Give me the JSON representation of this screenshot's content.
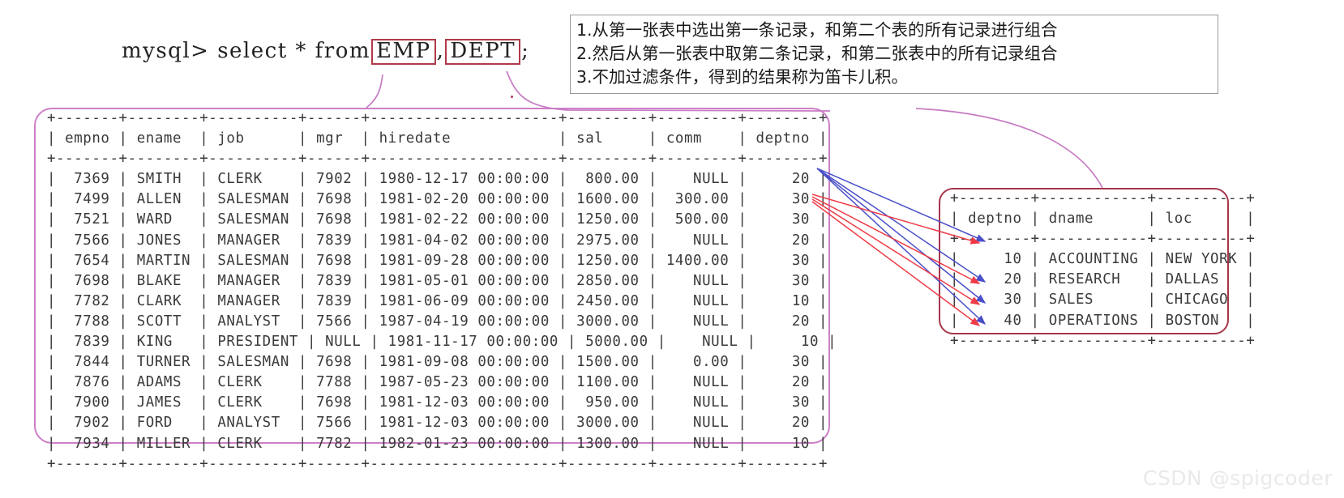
{
  "prompt": {
    "before": "mysql> select * from ",
    "table1": "EMP",
    "comma": ", ",
    "table2": "DEPT",
    "terminator": ";"
  },
  "note": {
    "line1": "1.从第一张表中选出第一条记录，和第二个表的所有记录进行组合",
    "line2": "2.然后从第一张表中取第二条记录，和第二张表中的所有记录组合",
    "line3": "3.不加过滤条件，得到的结果称为笛卡儿积。"
  },
  "emp_table": {
    "columns": [
      "empno",
      "ename",
      "job",
      "mgr",
      "hiredate",
      "sal",
      "comm",
      "deptno"
    ],
    "widths": [
      7,
      8,
      10,
      6,
      21,
      9,
      9,
      8
    ],
    "aligns": [
      "right",
      "left",
      "left",
      "right",
      "left",
      "right",
      "right",
      "right"
    ],
    "rows": [
      [
        "7369",
        "SMITH",
        "CLERK",
        "7902",
        "1980-12-17 00:00:00",
        "800.00",
        "NULL",
        "20"
      ],
      [
        "7499",
        "ALLEN",
        "SALESMAN",
        "7698",
        "1981-02-20 00:00:00",
        "1600.00",
        "300.00",
        "30"
      ],
      [
        "7521",
        "WARD",
        "SALESMAN",
        "7698",
        "1981-02-22 00:00:00",
        "1250.00",
        "500.00",
        "30"
      ],
      [
        "7566",
        "JONES",
        "MANAGER",
        "7839",
        "1981-04-02 00:00:00",
        "2975.00",
        "NULL",
        "20"
      ],
      [
        "7654",
        "MARTIN",
        "SALESMAN",
        "7698",
        "1981-09-28 00:00:00",
        "1250.00",
        "1400.00",
        "30"
      ],
      [
        "7698",
        "BLAKE",
        "MANAGER",
        "7839",
        "1981-05-01 00:00:00",
        "2850.00",
        "NULL",
        "30"
      ],
      [
        "7782",
        "CLARK",
        "MANAGER",
        "7839",
        "1981-06-09 00:00:00",
        "2450.00",
        "NULL",
        "10"
      ],
      [
        "7788",
        "SCOTT",
        "ANALYST",
        "7566",
        "1987-04-19 00:00:00",
        "3000.00",
        "NULL",
        "20"
      ],
      [
        "7839",
        "KING",
        "PRESIDENT",
        "NULL",
        "1981-11-17 00:00:00",
        "5000.00",
        "NULL",
        "10"
      ],
      [
        "7844",
        "TURNER",
        "SALESMAN",
        "7698",
        "1981-09-08 00:00:00",
        "1500.00",
        "0.00",
        "30"
      ],
      [
        "7876",
        "ADAMS",
        "CLERK",
        "7788",
        "1987-05-23 00:00:00",
        "1100.00",
        "NULL",
        "20"
      ],
      [
        "7900",
        "JAMES",
        "CLERK",
        "7698",
        "1981-12-03 00:00:00",
        "950.00",
        "NULL",
        "30"
      ],
      [
        "7902",
        "FORD",
        "ANALYST",
        "7566",
        "1981-12-03 00:00:00",
        "3000.00",
        "NULL",
        "20"
      ],
      [
        "7934",
        "MILLER",
        "CLERK",
        "7782",
        "1982-01-23 00:00:00",
        "1300.00",
        "NULL",
        "10"
      ]
    ]
  },
  "dept_table": {
    "columns": [
      "deptno",
      "dname",
      "loc"
    ],
    "widths": [
      8,
      12,
      10
    ],
    "aligns": [
      "right",
      "left",
      "left"
    ],
    "rows": [
      [
        "10",
        "ACCOUNTING",
        "NEW YORK"
      ],
      [
        "20",
        "RESEARCH",
        "DALLAS"
      ],
      [
        "30",
        "SALES",
        "CHICAGO"
      ],
      [
        "40",
        "OPERATIONS",
        "BOSTON"
      ]
    ]
  },
  "watermark": {
    "text": "CSDN @spigcoder"
  },
  "colors": {
    "emp_frame": "#cc7fc8",
    "dept_frame": "#a5364a",
    "highlight_box": "#b03a4a",
    "connector": "#c77cc4",
    "arrow_blue": "#4a50c8",
    "arrow_red": "#ee3b46",
    "note_border": "#9a9a9a"
  }
}
